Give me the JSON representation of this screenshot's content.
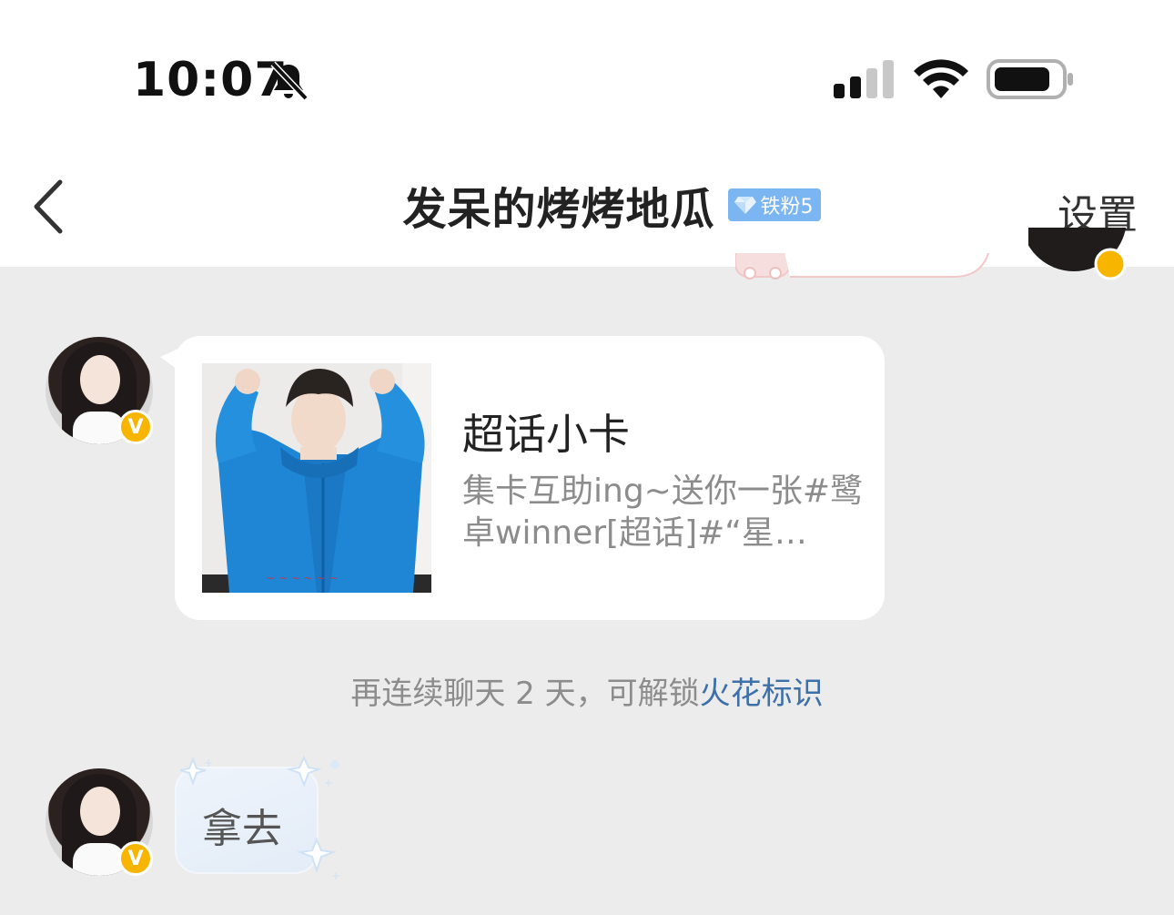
{
  "status_bar": {
    "time": "10:07",
    "icons": [
      "bell-muted-icon",
      "cellular-signal-icon",
      "wifi-icon",
      "battery-icon"
    ]
  },
  "nav": {
    "back_icon": "chevron-left-icon",
    "title": "发呆的烤烤地瓜",
    "fan_badge": "铁粉5",
    "settings_label": "设置"
  },
  "messages": {
    "card": {
      "title": "超话小卡",
      "description": "集卡互助ing~送你一张#鹭卓winner[超话]#“星…",
      "avatar_badge": "V",
      "thumbnail_icon": "photo-thumbnail"
    },
    "notice": {
      "prefix": "再连续聊天 2 天，可解锁",
      "link": "火花标识"
    },
    "text_message": {
      "text": "拿去",
      "avatar_badge": "V"
    }
  },
  "colors": {
    "nav_background": "#ffffff",
    "chat_background": "#ececec",
    "link": "#3d6fa8",
    "fan_badge": "#7bb6f3",
    "verified_badge": "#f7b500"
  }
}
